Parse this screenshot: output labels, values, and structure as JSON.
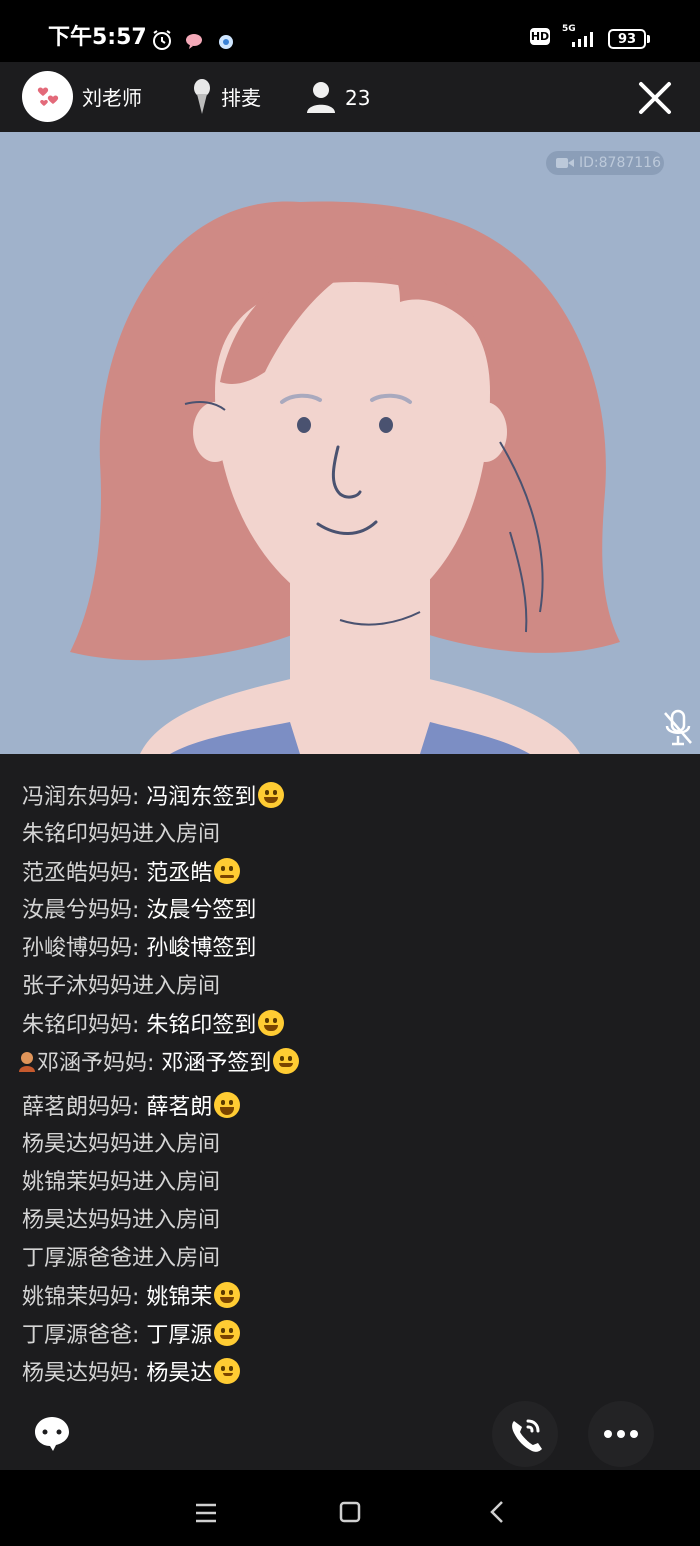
{
  "status_bar": {
    "time": "下午5:57",
    "hd_label": "HD",
    "network": "5G",
    "battery": "93"
  },
  "header": {
    "teacher_name": "刘老师",
    "queue_label": "排麦",
    "viewer_count": "23"
  },
  "video": {
    "room_id": "ID:8787116"
  },
  "chat": {
    "messages": [
      {
        "user": "冯润东妈妈: ",
        "text": "冯润东签到",
        "emoji": "grin-emoji"
      },
      {
        "user": "朱铭印妈妈进入房间",
        "text": ""
      },
      {
        "user": "范丞皓妈妈: ",
        "text": "范丞皓",
        "emoji": "thinking-emoji"
      },
      {
        "user": "汝晨兮妈妈: ",
        "text": "汝晨兮签到"
      },
      {
        "user": "孙峻博妈妈: ",
        "text": "孙峻博签到"
      },
      {
        "user": "张子沐妈妈进入房间",
        "text": ""
      },
      {
        "user": "朱铭印妈妈: ",
        "text": "朱铭印签到",
        "emoji": "grin-emoji"
      },
      {
        "user": "邓涵予妈妈: ",
        "text": "邓涵予签到",
        "emoji": "smile-emoji",
        "badge": "person-badge"
      },
      {
        "user": "薛茗朗妈妈: ",
        "text": "薛茗朗",
        "emoji": "laugh-emoji"
      },
      {
        "user": "杨昊达妈妈进入房间",
        "text": ""
      },
      {
        "user": "姚锦茉妈妈进入房间",
        "text": ""
      },
      {
        "user": "杨昊达妈妈进入房间",
        "text": ""
      },
      {
        "user": "丁厚源爸爸进入房间",
        "text": ""
      },
      {
        "user": "姚锦茉妈妈: ",
        "text": "姚锦茉",
        "emoji": "grin-emoji"
      },
      {
        "user": "丁厚源爸爸: ",
        "text": "丁厚源",
        "emoji": "hug-emoji"
      },
      {
        "user": "杨昊达妈妈: ",
        "text": "杨昊达",
        "emoji": "smirk-emoji"
      }
    ]
  },
  "colors": {
    "background": "#1c1c1e",
    "video_bg": "#a0b2cb",
    "hair": "#cf8a85",
    "skin": "#f2d4ce"
  }
}
